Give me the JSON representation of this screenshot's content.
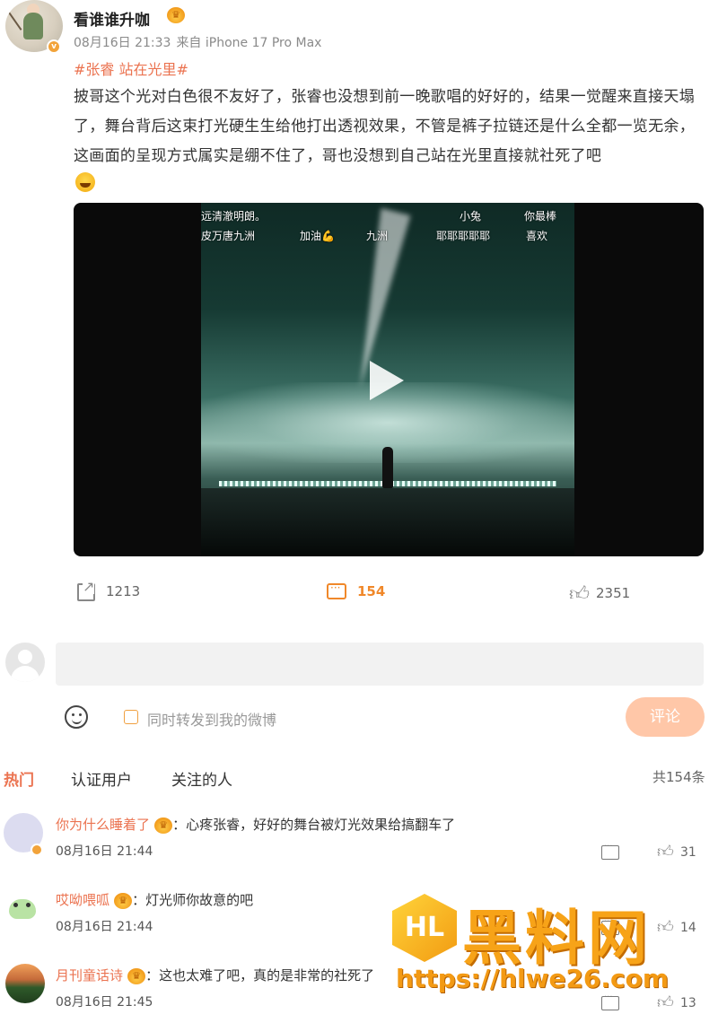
{
  "post": {
    "username": "看谁谁升咖",
    "crown_icon": "crown-icon",
    "date": "08月16日 21:33",
    "source": "来自 iPhone 17 Pro Max",
    "hashtag": "#张睿 站在光里#",
    "body": "披哥这个光对白色很不友好了，张睿也没想到前一晚歌唱的好好的，结果一觉醒来直接天塌了，舞台背后这束打光硬生生给他打出透视效果，不管是裤子拉链还是什么全都一览无余，这画面的呈现方式属实是绷不住了，哥也没想到自己站在光里直接就社死了吧",
    "emoji": "laugh-cry-emoji"
  },
  "video": {
    "danmaku": {
      "d1": "远清澈明朗。",
      "d2": "小兔",
      "d3": "你最棒",
      "d4": "皮万唐九洲",
      "d5": "加油💪",
      "d6": "九洲",
      "d7": "耶耶耶耶耶",
      "d8": "喜欢"
    }
  },
  "actions": {
    "share_count": "1213",
    "comment_count": "154",
    "like_count": "2351"
  },
  "compose": {
    "input_value": "",
    "repost_label": "同时转发到我的微博",
    "submit_label": "评论"
  },
  "tabs": {
    "hot": "热门",
    "verified": "认证用户",
    "following": "关注的人",
    "total": "共154条"
  },
  "comments": [
    {
      "name": "你为什么睡着了",
      "text": "心疼张睿，好好的舞台被灯光效果给搞翻车了",
      "time": "08月16日 21:44",
      "likes": "31"
    },
    {
      "name": "哎呦喂呱",
      "text": "灯光师你故意的吧",
      "time": "08月16日 21:44",
      "likes": "14"
    },
    {
      "name": "月刊童话诗",
      "text": "这也太难了吧，真的是非常的社死了",
      "time": "08月16日 21:45",
      "likes": "13"
    }
  ],
  "watermark": {
    "logo_text": "HL",
    "title": "黑料网",
    "url": "https://hlwe26.com"
  },
  "colors": {
    "accent": "#eb7350",
    "comment_orange": "#f0882a",
    "submit_bg": "#ffc7a8"
  }
}
